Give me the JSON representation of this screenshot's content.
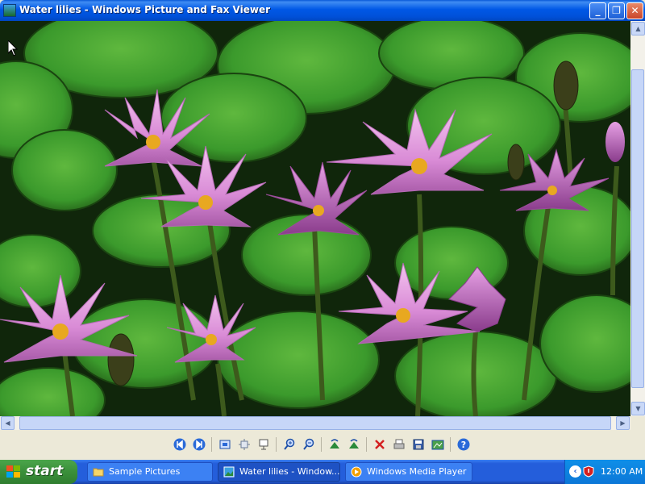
{
  "window": {
    "title": "Water lilies - Windows Picture and Fax Viewer",
    "minimize": "_",
    "maximize": "❐",
    "close": "✕"
  },
  "toolbar": {
    "tools": [
      {
        "name": "previous-image-icon"
      },
      {
        "name": "next-image-icon"
      },
      {
        "name": "best-fit-icon"
      },
      {
        "name": "actual-size-icon"
      },
      {
        "name": "slideshow-icon"
      },
      {
        "name": "zoom-in-icon"
      },
      {
        "name": "zoom-out-icon"
      },
      {
        "name": "rotate-clockwise-icon"
      },
      {
        "name": "rotate-counterclockwise-icon"
      },
      {
        "name": "delete-icon"
      },
      {
        "name": "print-icon"
      },
      {
        "name": "save-icon"
      },
      {
        "name": "edit-icon"
      },
      {
        "name": "help-icon"
      }
    ]
  },
  "taskbar": {
    "start_label": "start",
    "tasks": [
      {
        "label": "Sample Pictures",
        "icon": "folder-icon",
        "active": false
      },
      {
        "label": "Water lilies - Window...",
        "icon": "picture-viewer-icon",
        "active": true
      },
      {
        "label": "Windows Media Player",
        "icon": "media-player-icon",
        "active": false
      }
    ],
    "clock": "12:00 AM"
  },
  "colors": {
    "titlebar": "#0058e6",
    "taskbar": "#245edb",
    "start": "#3a8f3a",
    "lily_petal": "#e7a2e0",
    "lily_center": "#e8a820",
    "pad": "#3b9a2c"
  }
}
